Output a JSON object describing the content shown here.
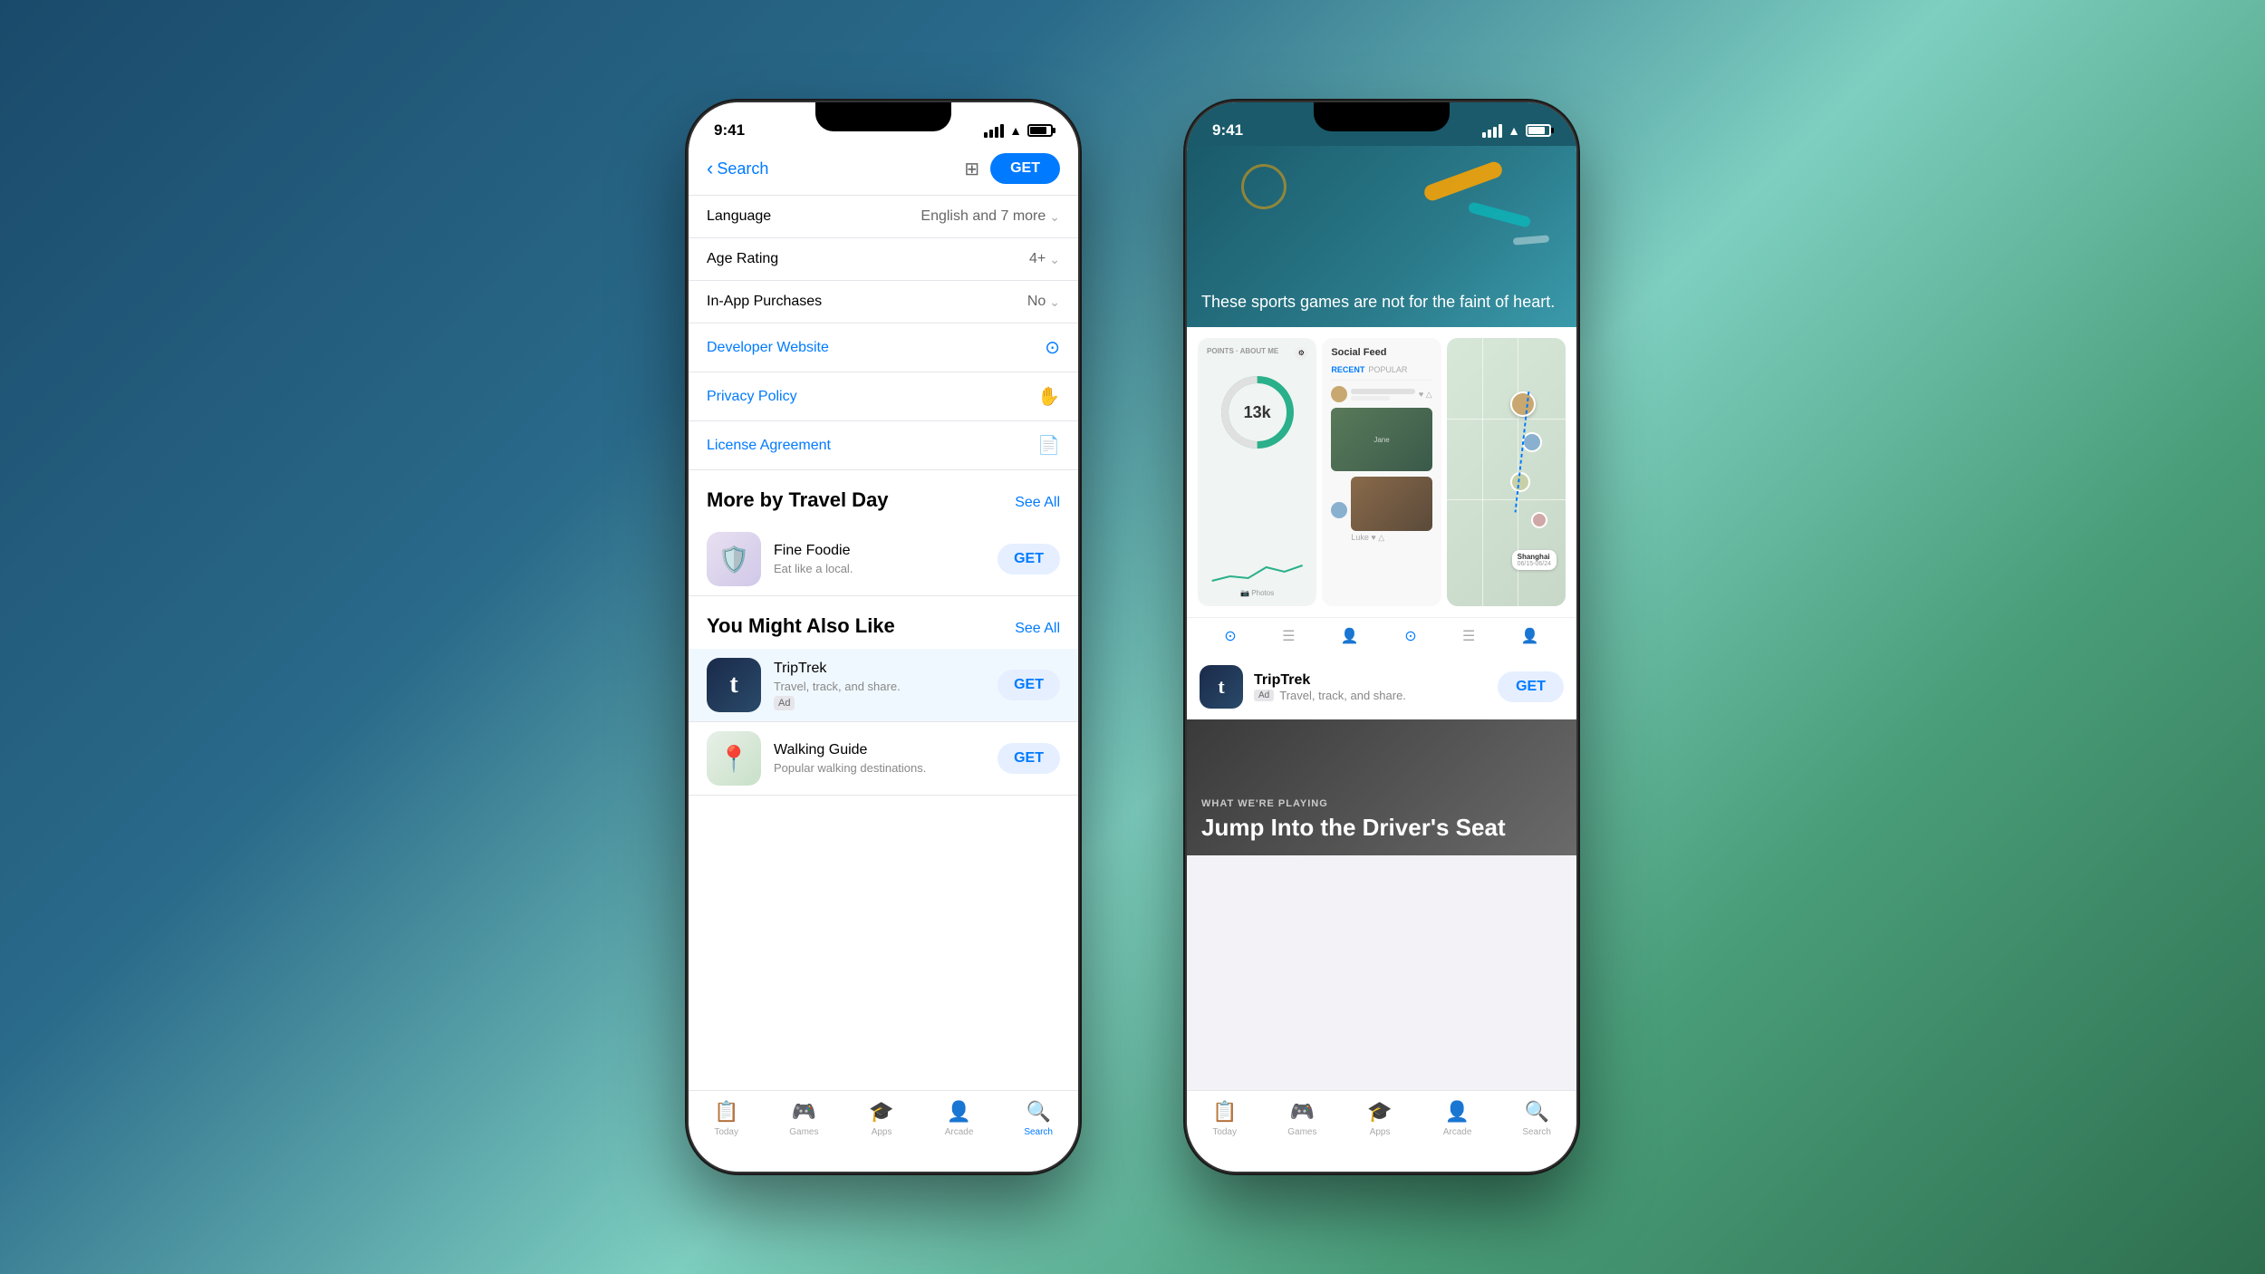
{
  "background": {
    "gradient": "linear-gradient(135deg, #1a4a6b, #2a6a8a, #7ecfc0, #4a9e7a, #2d6e4e)"
  },
  "left_phone": {
    "status_bar": {
      "time": "9:41",
      "signal": "signal",
      "wifi": "wifi",
      "battery": "battery"
    },
    "nav": {
      "back_label": "Search",
      "filter_label": "filter",
      "get_label": "GET"
    },
    "info_rows": [
      {
        "label": "Language",
        "value": "English and 7 more",
        "type": "dropdown"
      },
      {
        "label": "Age Rating",
        "value": "4+",
        "type": "dropdown"
      },
      {
        "label": "In-App Purchases",
        "value": "No",
        "type": "dropdown"
      }
    ],
    "links": [
      {
        "label": "Developer Website",
        "icon": "compass"
      },
      {
        "label": "Privacy Policy",
        "icon": "hand"
      },
      {
        "label": "License Agreement",
        "icon": "document"
      }
    ],
    "more_section": {
      "title": "More by Travel Day",
      "see_all": "See All",
      "apps": [
        {
          "name": "Fine Foodie",
          "description": "Eat like a local.",
          "icon_letter": "🛡",
          "get_label": "GET",
          "ad": false
        }
      ]
    },
    "also_like_section": {
      "title": "You Might Also Like",
      "see_all": "See All",
      "apps": [
        {
          "name": "TripTrek",
          "description": "Travel, track, and share.",
          "icon_letter": "t",
          "get_label": "GET",
          "ad": true
        },
        {
          "name": "Walking Guide",
          "description": "Popular walking destinations.",
          "icon_letter": "📍",
          "get_label": "GET",
          "ad": false
        }
      ]
    },
    "tab_bar": {
      "tabs": [
        {
          "icon": "📋",
          "label": "Today",
          "active": false
        },
        {
          "icon": "🎮",
          "label": "Games",
          "active": false
        },
        {
          "icon": "🎓",
          "label": "Apps",
          "active": false
        },
        {
          "icon": "👤",
          "label": "Arcade",
          "active": false
        },
        {
          "icon": "🔍",
          "label": "Search",
          "active": true
        }
      ]
    }
  },
  "right_phone": {
    "status_bar": {
      "time": "9:41"
    },
    "hero_card": {
      "text": "These sports games are not for the faint of heart."
    },
    "app_promo": {
      "name": "TripTrek",
      "ad_badge": "Ad",
      "description": "Travel, track, and share.",
      "get_label": "GET"
    },
    "playing_card": {
      "label": "WHAT WE'RE PLAYING",
      "title": "Jump Into the Driver's Seat"
    },
    "tab_bar": {
      "tabs": [
        {
          "icon": "📋",
          "label": "Today",
          "active": false
        },
        {
          "icon": "🎮",
          "label": "Games",
          "active": false
        },
        {
          "icon": "🎓",
          "label": "Apps",
          "active": false
        },
        {
          "icon": "👤",
          "label": "Arcade",
          "active": false
        },
        {
          "icon": "🔍",
          "label": "Search",
          "active": false
        }
      ]
    }
  }
}
